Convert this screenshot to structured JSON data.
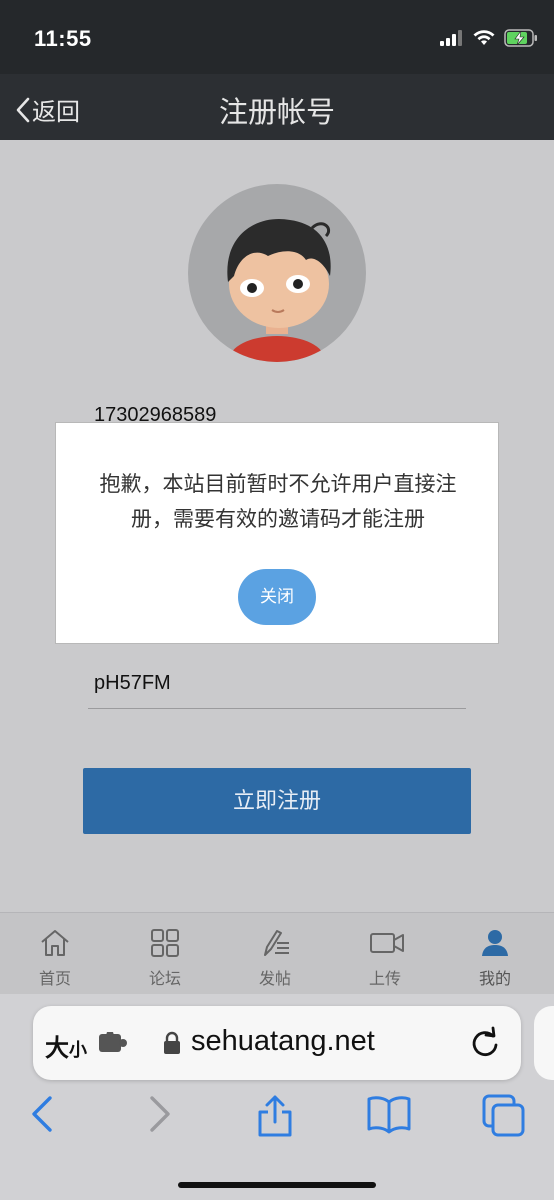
{
  "status_bar": {
    "time": "11:55"
  },
  "nav": {
    "back_label": "返回",
    "title": "注册帐号"
  },
  "form": {
    "phone_value": "17302968589",
    "invite_value": "pH57FM",
    "submit_label": "立即注册"
  },
  "dialog": {
    "message": "抱歉，本站目前暂时不允许用户直接注册，需要有效的邀请码才能注册",
    "close_label": "关闭"
  },
  "tabbar": {
    "items": [
      {
        "label": "首页",
        "icon": "home-icon"
      },
      {
        "label": "论坛",
        "icon": "grid-icon"
      },
      {
        "label": "发帖",
        "icon": "compose-icon"
      },
      {
        "label": "上传",
        "icon": "video-icon"
      },
      {
        "label": "我的",
        "icon": "person-icon",
        "active": true
      }
    ]
  },
  "browser": {
    "text_size_big": "大",
    "text_size_small": "小",
    "url": "sehuatang.net"
  },
  "colors": {
    "accent": "#2d6aa5",
    "dialog_button": "#5ba2e2",
    "browser_blue": "#2f7de1"
  }
}
